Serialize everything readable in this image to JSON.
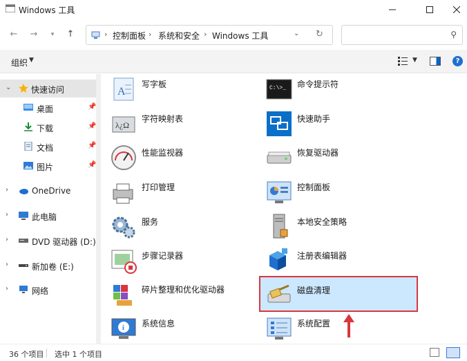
{
  "window": {
    "title": "Windows 工具"
  },
  "address": {
    "crumbs": [
      "控制面板",
      "系统和安全",
      "Windows 工具"
    ],
    "search_placeholder": ""
  },
  "commandbar": {
    "organize_label": "组织"
  },
  "sidebar": {
    "items": [
      {
        "label": "快速访问",
        "icon": "star-icon"
      },
      {
        "label": "桌面",
        "icon": "desktop-icon"
      },
      {
        "label": "下载",
        "icon": "download-icon"
      },
      {
        "label": "文档",
        "icon": "document-icon"
      },
      {
        "label": "图片",
        "icon": "pictures-icon"
      },
      {
        "label": "OneDrive",
        "icon": "cloud-icon"
      },
      {
        "label": "此电脑",
        "icon": "pc-icon"
      },
      {
        "label": "DVD 驱动器 (D:) CC",
        "icon": "dvd-icon"
      },
      {
        "label": "新加卷 (E:)",
        "icon": "drive-icon"
      },
      {
        "label": "网络",
        "icon": "network-icon"
      }
    ]
  },
  "content": {
    "items": [
      {
        "label": "写字板",
        "icon": "wordpad-icon"
      },
      {
        "label": "命令提示符",
        "icon": "cmd-icon"
      },
      {
        "label": "字符映射表",
        "icon": "charmap-icon"
      },
      {
        "label": "快速助手",
        "icon": "quick-assist-icon"
      },
      {
        "label": "性能监视器",
        "icon": "perfmon-icon"
      },
      {
        "label": "恢复驱动器",
        "icon": "recovery-drive-icon"
      },
      {
        "label": "打印管理",
        "icon": "print-management-icon"
      },
      {
        "label": "控制面板",
        "icon": "control-panel-icon"
      },
      {
        "label": "服务",
        "icon": "services-icon"
      },
      {
        "label": "本地安全策略",
        "icon": "security-policy-icon"
      },
      {
        "label": "步骤记录器",
        "icon": "steps-recorder-icon"
      },
      {
        "label": "注册表编辑器",
        "icon": "regedit-icon"
      },
      {
        "label": "碎片整理和优化驱动器",
        "icon": "defrag-icon"
      },
      {
        "label": "磁盘清理",
        "icon": "disk-cleanup-icon"
      },
      {
        "label": "系统信息",
        "icon": "system-info-icon"
      },
      {
        "label": "系统配置",
        "icon": "msconfig-icon"
      }
    ],
    "selected_label": "磁盘清理"
  },
  "status": {
    "item_count": "36 个项目",
    "selection": "选中 1 个项目"
  },
  "colors": {
    "selection_bg": "#cce8ff",
    "highlight_border": "#d9363e",
    "accent": "#1f6fd1"
  }
}
